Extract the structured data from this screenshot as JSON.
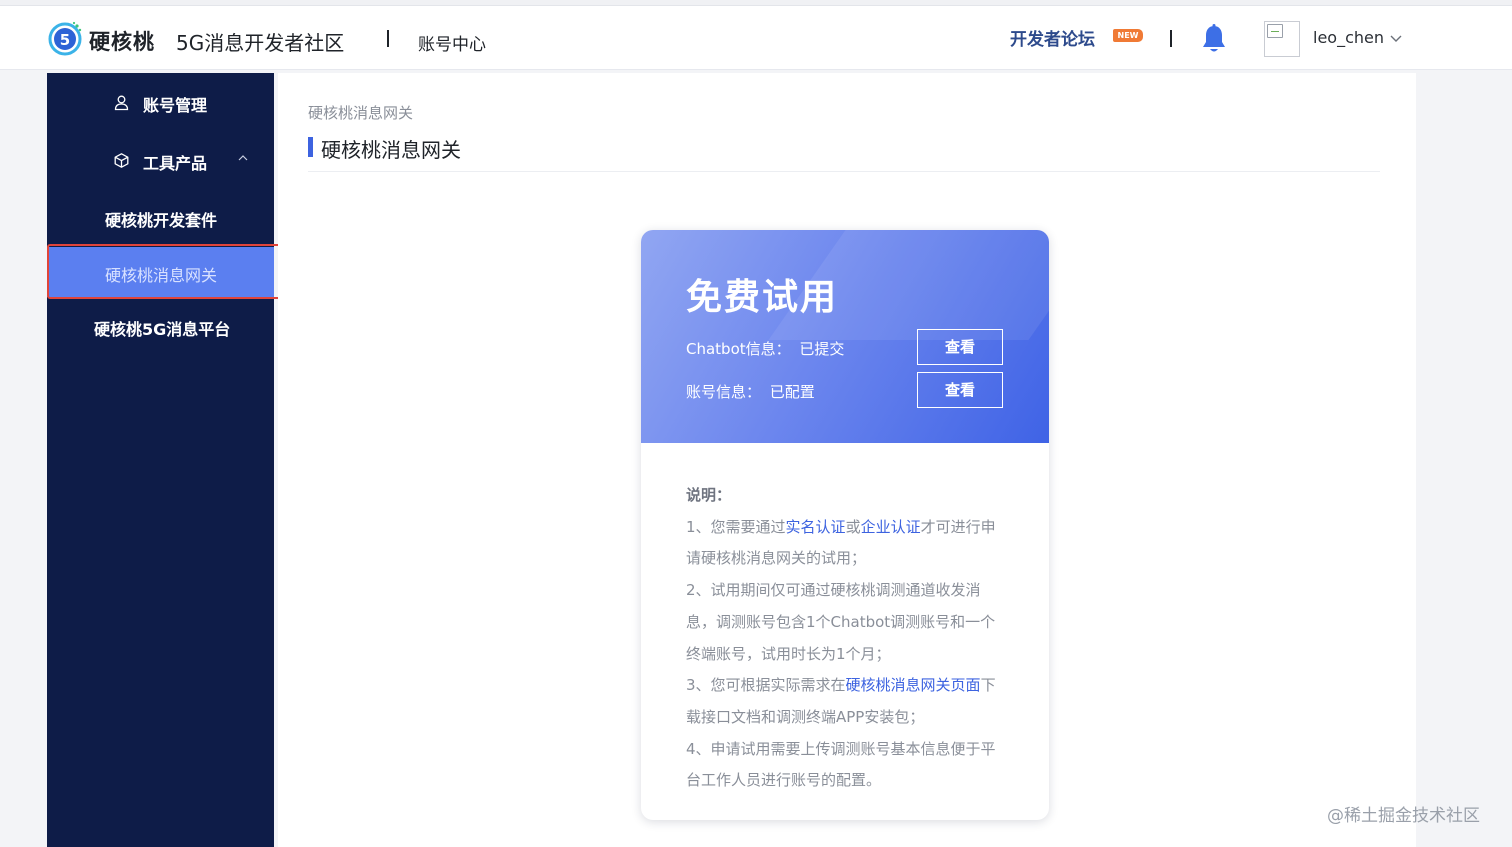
{
  "header": {
    "brand_name": "硬核桃",
    "brand_sub": "5G消息开发者社区",
    "section": "账号中心",
    "forum_link": "开发者论坛",
    "new_badge": "NEW",
    "username": "leo_chen"
  },
  "sidebar": {
    "items": [
      {
        "label": "账号管理"
      },
      {
        "label": "工具产品"
      },
      {
        "label": "硬核桃开发套件"
      },
      {
        "label": "硬核桃消息网关"
      },
      {
        "label": "硬核桃5G消息平台"
      }
    ]
  },
  "content": {
    "breadcrumb": "硬核桃消息网关",
    "title": "硬核桃消息网关"
  },
  "card": {
    "title": "免费试用",
    "rows": [
      {
        "label": "Chatbot信息：",
        "status": "已提交",
        "button": "查看"
      },
      {
        "label": "账号信息：",
        "status": "已配置",
        "button": "查看"
      }
    ],
    "notes_title": "说明：",
    "note1_pre": "1、您需要通过",
    "note1_link1": "实名认证",
    "note1_mid": "或",
    "note1_link2": "企业认证",
    "note1_post": "才可进行申请硬核桃消息网关的试用；",
    "note2": "2、试用期间仅可通过硬核桃调测通道收发消息，调测账号包含1个Chatbot调测账号和一个终端账号，试用时长为1个月；",
    "note3_pre": "3、您可根据实际需求在",
    "note3_link": "硬核桃消息网关页面",
    "note3_post": "下载接口文档和调测终端APP安装包；",
    "note4": "4、申请试用需要上传调测账号基本信息便于平台工作人员进行账号的配置。"
  },
  "watermark": "@稀土掘金技术社区",
  "colors": {
    "sidebar_bg": "#0e1c48",
    "active_item": "#5b7ff0",
    "accent": "#3d63e0",
    "highlight": "#e0443a"
  }
}
